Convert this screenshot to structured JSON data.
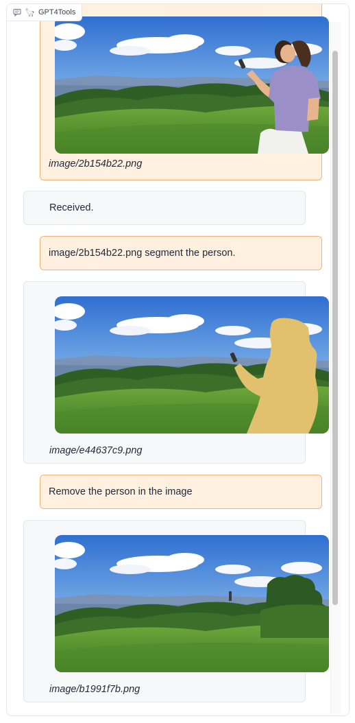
{
  "app": {
    "label": "GPT4Tools",
    "chat_icon": "chat-bubble-icon",
    "llama_icon": "llama-emoji-icon"
  },
  "messages": [
    {
      "role": "user",
      "image": "beach-hill-woman-phone",
      "caption": "image/2b154b22.png"
    },
    {
      "role": "bot",
      "text": "Received."
    },
    {
      "role": "user",
      "text": "image/2b154b22.png segment the person."
    },
    {
      "role": "bot",
      "image": "segmented-person-mask",
      "caption": "image/e44637c9.png"
    },
    {
      "role": "user",
      "text": "Remove the person in the image"
    },
    {
      "role": "bot",
      "image": "person-removed-landscape",
      "caption": "image/b1991f7b.png"
    }
  ],
  "colors": {
    "user_bg": "#fff0e0",
    "user_border": "#f5b371",
    "bot_bg": "#f7f8fa",
    "mask": "#e1c16e"
  }
}
